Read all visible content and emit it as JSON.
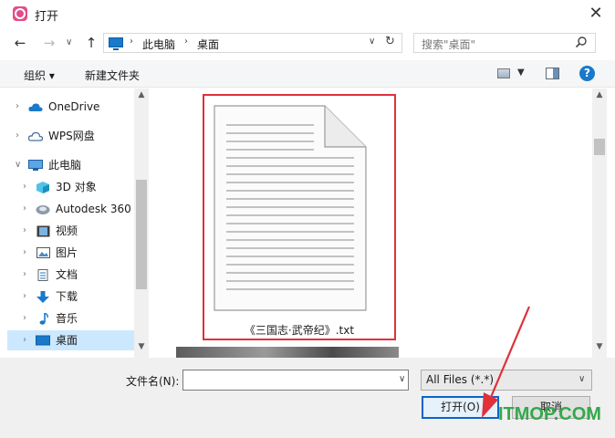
{
  "window": {
    "title": "打开"
  },
  "address": {
    "crumbs": [
      "此电脑",
      "桌面"
    ],
    "search_placeholder": "搜索\"桌面\""
  },
  "toolbar": {
    "organize": "组织 ▾",
    "new_folder": "新建文件夹"
  },
  "nav": {
    "items": [
      {
        "label": "OneDrive",
        "icon": "cloud-icon"
      },
      {
        "label": "WPS网盘",
        "icon": "cloud-outline-icon"
      },
      {
        "label": "此电脑",
        "icon": "pc-icon"
      },
      {
        "label": "3D 对象",
        "icon": "cube-icon"
      },
      {
        "label": "Autodesk 360",
        "icon": "autodesk-icon"
      },
      {
        "label": "视频",
        "icon": "video-icon"
      },
      {
        "label": "图片",
        "icon": "picture-icon"
      },
      {
        "label": "文档",
        "icon": "document-icon"
      },
      {
        "label": "下载",
        "icon": "download-icon"
      },
      {
        "label": "音乐",
        "icon": "music-icon"
      },
      {
        "label": "桌面",
        "icon": "desktop-icon"
      }
    ]
  },
  "content": {
    "file_name": "《三国志·武帝纪》.txt"
  },
  "bottom": {
    "filename_label": "文件名(N):",
    "filetype": "All Files (*.*)",
    "open": "打开(O)",
    "cancel": "取消"
  },
  "watermark": "ITMOP.COM",
  "colors": {
    "accent": "#1979ca",
    "highlight": "#e0303a",
    "selected": "#cce8ff",
    "watermark": "#35a84a"
  }
}
